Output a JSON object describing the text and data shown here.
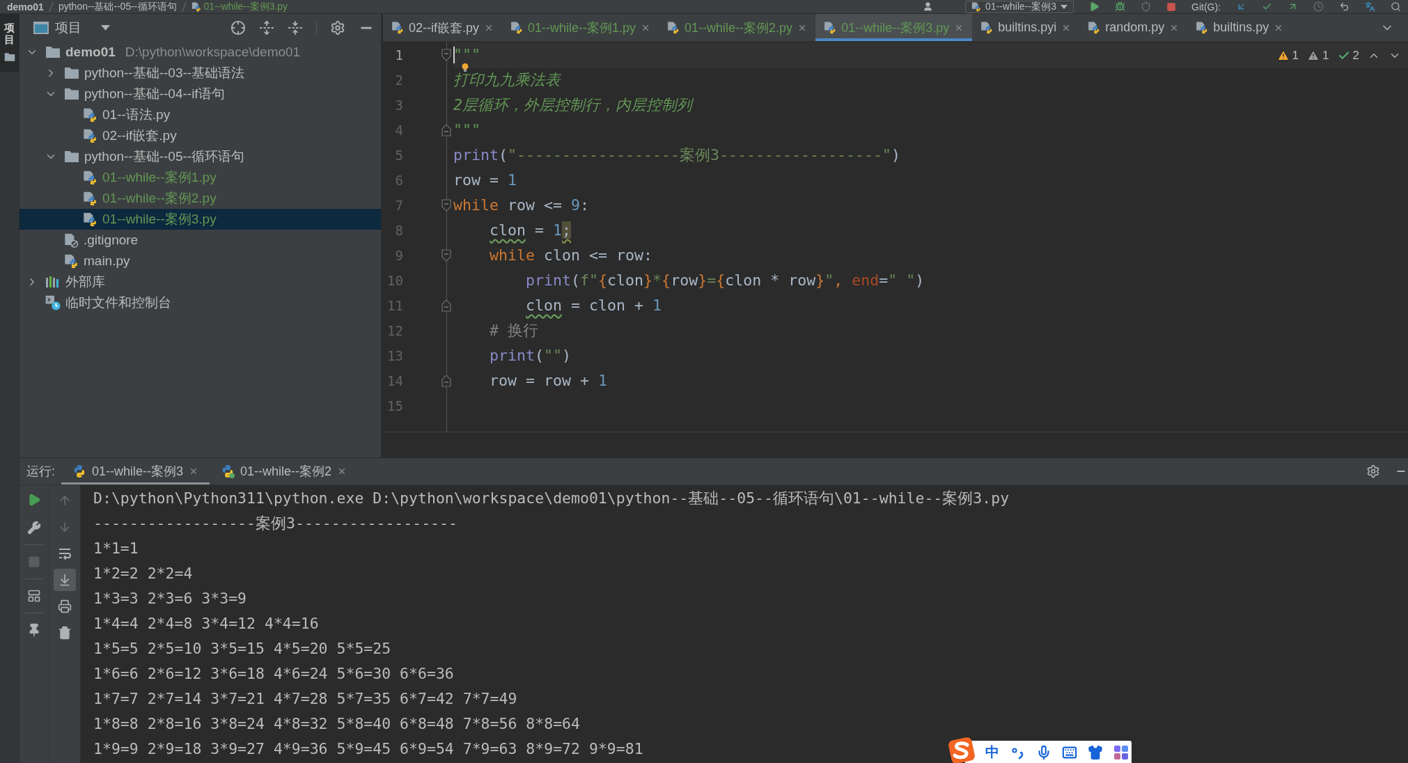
{
  "top_bar": {
    "breadcrumbs": [
      {
        "label": "demo01",
        "kind": "project"
      },
      {
        "label": "python--基础--05--循环语句",
        "kind": "folder"
      },
      {
        "label": "01--while--案例3.py",
        "kind": "file"
      }
    ],
    "run_config": "01--while--案例3",
    "vcs_label": "Git(G):"
  },
  "tool_strip": {
    "tabs": [
      {
        "label": "项目",
        "selected": true
      }
    ]
  },
  "project_panel": {
    "title": "项目",
    "tree": [
      {
        "label": "demo01",
        "hint": "D:\\python\\workspace\\demo01",
        "kind": "project",
        "expanded": true,
        "selected": false,
        "added": false,
        "children": [
          {
            "label": "python--基础--03--基础语法",
            "kind": "folder",
            "expanded": false,
            "selected": false,
            "added": false
          },
          {
            "label": "python--基础--04--if语句",
            "kind": "folder",
            "expanded": true,
            "selected": false,
            "added": false,
            "children": [
              {
                "label": "01--语法.py",
                "kind": "python",
                "selected": false,
                "added": false
              },
              {
                "label": "02--if嵌套.py",
                "kind": "python",
                "selected": false,
                "added": false
              }
            ]
          },
          {
            "label": "python--基础--05--循环语句",
            "kind": "folder",
            "expanded": true,
            "selected": false,
            "added": false,
            "children": [
              {
                "label": "01--while--案例1.py",
                "kind": "python",
                "selected": false,
                "added": true
              },
              {
                "label": "01--while--案例2.py",
                "kind": "python",
                "selected": false,
                "added": true
              },
              {
                "label": "01--while--案例3.py",
                "kind": "python",
                "selected": true,
                "added": true
              }
            ]
          },
          {
            "label": ".gitignore",
            "kind": "ignore",
            "selected": false,
            "added": false
          },
          {
            "label": "main.py",
            "kind": "python",
            "selected": false,
            "added": false
          }
        ]
      },
      {
        "label": "外部库",
        "kind": "library",
        "expanded": false,
        "selected": false,
        "added": false
      },
      {
        "label": "临时文件和控制台",
        "kind": "scratch",
        "selected": false,
        "added": false
      }
    ]
  },
  "editor": {
    "tabs": [
      {
        "label": "02--if嵌套.py",
        "selected": false,
        "added": false
      },
      {
        "label": "01--while--案例1.py",
        "selected": false,
        "added": true
      },
      {
        "label": "01--while--案例2.py",
        "selected": false,
        "added": true
      },
      {
        "label": "01--while--案例3.py",
        "selected": true,
        "added": true
      },
      {
        "label": "builtins.pyi",
        "selected": false,
        "added": false
      },
      {
        "label": "random.py",
        "selected": false,
        "added": false
      },
      {
        "label": "builtins.py",
        "selected": false,
        "added": false
      }
    ],
    "inspections": [
      {
        "kind": "warning",
        "count": "1"
      },
      {
        "kind": "weak_warning",
        "count": "1"
      },
      {
        "kind": "typo",
        "count": "2"
      }
    ],
    "lines": [
      {
        "number": "1",
        "kind": "fold_start",
        "current": true,
        "bulb": false,
        "tokens": [
          {
            "kind": "doc",
            "text": "\"\"\""
          }
        ]
      },
      {
        "number": "2",
        "kind": "plain",
        "current": false,
        "bulb": true,
        "tokens": [
          {
            "kind": "doc",
            "text": "打印九九乘法表"
          }
        ]
      },
      {
        "number": "3",
        "kind": "plain",
        "current": false,
        "bulb": false,
        "tokens": [
          {
            "kind": "doc",
            "text": "2层循环，外层控制行，内层控制列"
          }
        ]
      },
      {
        "number": "4",
        "kind": "fold_end",
        "current": false,
        "bulb": false,
        "tokens": [
          {
            "kind": "doc",
            "text": "\"\"\""
          }
        ]
      },
      {
        "number": "5",
        "kind": "plain",
        "current": false,
        "bulb": false,
        "tokens": [
          {
            "kind": "builtin",
            "text": "print"
          },
          {
            "kind": "plain",
            "text": "("
          },
          {
            "kind": "string",
            "text": "\"------------------案例3------------------\""
          },
          {
            "kind": "plain",
            "text": ")"
          }
        ]
      },
      {
        "number": "6",
        "kind": "plain",
        "current": false,
        "bulb": false,
        "tokens": [
          {
            "kind": "plain",
            "text": "row = "
          },
          {
            "kind": "number",
            "text": "1"
          }
        ]
      },
      {
        "number": "7",
        "kind": "fold_start",
        "current": false,
        "bulb": false,
        "tokens": [
          {
            "kind": "keyword",
            "text": "while"
          },
          {
            "kind": "plain",
            "text": " row <= "
          },
          {
            "kind": "number",
            "text": "9"
          },
          {
            "kind": "plain",
            "text": ":"
          }
        ],
        "children": [
          {
            "number": "8",
            "kind": "plain",
            "current": false,
            "bulb": false,
            "tokens": [
              {
                "kind": "typo",
                "text": "clon"
              },
              {
                "kind": "plain",
                "text": " = "
              },
              {
                "kind": "number",
                "text": "1"
              },
              {
                "kind": "warning",
                "text": ";"
              }
            ]
          },
          {
            "number": "9",
            "kind": "fold_start",
            "current": false,
            "bulb": false,
            "tokens": [
              {
                "kind": "keyword",
                "text": "while"
              },
              {
                "kind": "plain",
                "text": " clon <= row:"
              }
            ],
            "children": [
              {
                "number": "10",
                "kind": "plain",
                "current": false,
                "bulb": false,
                "tokens": [
                  {
                    "kind": "builtin",
                    "text": "print"
                  },
                  {
                    "kind": "plain",
                    "text": "("
                  },
                  {
                    "kind": "string",
                    "text": "f\""
                  },
                  {
                    "kind": "brace",
                    "text": "{"
                  },
                  {
                    "kind": "plain",
                    "text": "clon"
                  },
                  {
                    "kind": "brace",
                    "text": "}"
                  },
                  {
                    "kind": "string",
                    "text": "*"
                  },
                  {
                    "kind": "brace",
                    "text": "{"
                  },
                  {
                    "kind": "plain",
                    "text": "row"
                  },
                  {
                    "kind": "brace",
                    "text": "}"
                  },
                  {
                    "kind": "string",
                    "text": "="
                  },
                  {
                    "kind": "brace",
                    "text": "{"
                  },
                  {
                    "kind": "plain",
                    "text": "clon * row"
                  },
                  {
                    "kind": "brace",
                    "text": "}"
                  },
                  {
                    "kind": "string",
                    "text": "\""
                  },
                  {
                    "kind": "keyword",
                    "text": ", "
                  },
                  {
                    "kind": "param",
                    "text": "end"
                  },
                  {
                    "kind": "plain",
                    "text": "="
                  },
                  {
                    "kind": "string",
                    "text": "\" \""
                  },
                  {
                    "kind": "plain",
                    "text": ")"
                  }
                ]
              },
              {
                "number": "11",
                "kind": "fold_end",
                "current": false,
                "bulb": false,
                "tokens": [
                  {
                    "kind": "typo",
                    "text": "clon"
                  },
                  {
                    "kind": "plain",
                    "text": " = clon + "
                  },
                  {
                    "kind": "number",
                    "text": "1"
                  }
                ]
              }
            ]
          },
          {
            "number": "12",
            "kind": "plain",
            "current": false,
            "bulb": false,
            "tokens": [
              {
                "kind": "comment",
                "text": "# 换行"
              }
            ]
          },
          {
            "number": "13",
            "kind": "plain",
            "current": false,
            "bulb": false,
            "tokens": [
              {
                "kind": "builtin",
                "text": "print"
              },
              {
                "kind": "plain",
                "text": "("
              },
              {
                "kind": "string",
                "text": "\"\""
              },
              {
                "kind": "plain",
                "text": ")"
              }
            ]
          },
          {
            "number": "14",
            "kind": "fold_end",
            "current": false,
            "bulb": false,
            "tokens": [
              {
                "kind": "plain",
                "text": "row = row + "
              },
              {
                "kind": "number",
                "text": "1"
              }
            ]
          }
        ]
      },
      {
        "number": "15",
        "kind": "plain",
        "current": false,
        "bulb": false
      }
    ]
  },
  "run_panel": {
    "label": "运行:",
    "tabs": [
      {
        "label": "01--while--案例3",
        "selected": true,
        "running": false
      },
      {
        "label": "01--while--案例2",
        "selected": false,
        "running": true
      }
    ],
    "autoscroll": true,
    "output": [
      "D:\\python\\Python311\\python.exe D:\\python\\workspace\\demo01\\python--基础--05--循环语句\\01--while--案例3.py",
      "------------------案例3------------------",
      "1*1=1",
      "1*2=2 2*2=4",
      "1*3=3 2*3=6 3*3=9",
      "1*4=4 2*4=8 3*4=12 4*4=16",
      "1*5=5 2*5=10 3*5=15 4*5=20 5*5=25",
      "1*6=6 2*6=12 3*6=18 4*6=24 5*6=30 6*6=36",
      "1*7=7 2*7=14 3*7=21 4*7=28 5*7=35 6*7=42 7*7=49",
      "1*8=8 2*8=16 3*8=24 4*8=32 5*8=40 6*8=48 7*8=56 8*8=64",
      "1*9=9 2*9=18 3*9=27 4*9=36 5*9=45 6*9=54 7*9=63 8*9=72 9*9=81"
    ]
  },
  "ime_bar": {
    "mode": "中"
  }
}
